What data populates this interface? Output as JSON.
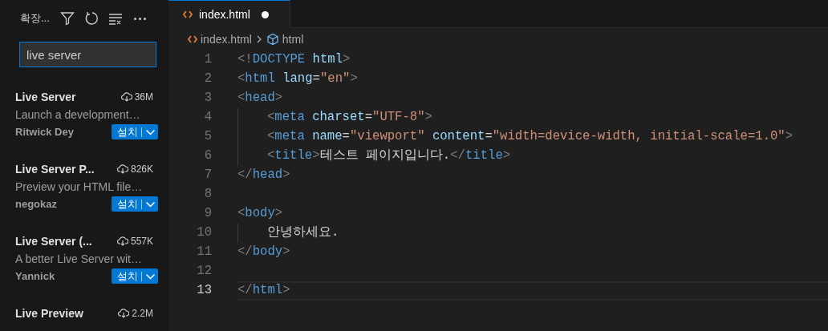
{
  "sidebar": {
    "title": "확장...",
    "search": {
      "value": "live server"
    },
    "extensions": [
      {
        "name": "Live Server",
        "downloads": "36M",
        "description": "Launch a development…",
        "author": "Ritwick Dey",
        "install": "설치"
      },
      {
        "name": "Live Server P...",
        "downloads": "826K",
        "description": "Preview your HTML file…",
        "author": "negokaz",
        "install": "설치"
      },
      {
        "name": "Live Server (...",
        "downloads": "557K",
        "description": "A better Live Server wit…",
        "author": "Yannick",
        "install": "설치"
      },
      {
        "name": "Live Preview",
        "downloads": "2.2M"
      }
    ]
  },
  "tabs": [
    {
      "label": "index.html",
      "selected": true,
      "modified": true
    }
  ],
  "breadcrumb": [
    "index.html",
    "html"
  ],
  "editor": {
    "lines": [
      {
        "number": "1",
        "indented": false,
        "current": false,
        "tokens": [
          {
            "kind": "punct",
            "text": "<!"
          },
          {
            "kind": "doctype",
            "text": "DOCTYPE"
          },
          {
            "kind": "attr",
            "text": " html"
          },
          {
            "kind": "punct",
            "text": ">"
          }
        ]
      },
      {
        "number": "2",
        "indented": false,
        "current": false,
        "tokens": [
          {
            "kind": "punct",
            "text": "<"
          },
          {
            "kind": "tag",
            "text": "html"
          },
          {
            "kind": "attr",
            "text": " lang"
          },
          {
            "kind": "text",
            "text": "="
          },
          {
            "kind": "string",
            "text": "\"en\""
          },
          {
            "kind": "punct",
            "text": ">"
          }
        ]
      },
      {
        "number": "3",
        "indented": false,
        "current": false,
        "tokens": [
          {
            "kind": "punct",
            "text": "<"
          },
          {
            "kind": "tag",
            "text": "head"
          },
          {
            "kind": "punct",
            "text": ">"
          }
        ]
      },
      {
        "number": "4",
        "indented": true,
        "current": false,
        "tokens": [
          {
            "kind": "punct",
            "text": "<"
          },
          {
            "kind": "tag",
            "text": "meta"
          },
          {
            "kind": "attr",
            "text": " charset"
          },
          {
            "kind": "text",
            "text": "="
          },
          {
            "kind": "string",
            "text": "\"UTF-8\""
          },
          {
            "kind": "punct",
            "text": ">"
          }
        ]
      },
      {
        "number": "5",
        "indented": true,
        "current": false,
        "tokens": [
          {
            "kind": "punct",
            "text": "<"
          },
          {
            "kind": "tag",
            "text": "meta"
          },
          {
            "kind": "attr",
            "text": " name"
          },
          {
            "kind": "text",
            "text": "="
          },
          {
            "kind": "string",
            "text": "\"viewport\""
          },
          {
            "kind": "attr",
            "text": " content"
          },
          {
            "kind": "text",
            "text": "="
          },
          {
            "kind": "string",
            "text": "\"width=device-width, initial-scale=1.0\""
          },
          {
            "kind": "punct",
            "text": ">"
          }
        ]
      },
      {
        "number": "6",
        "indented": true,
        "current": false,
        "tokens": [
          {
            "kind": "punct",
            "text": "<"
          },
          {
            "kind": "tag",
            "text": "title"
          },
          {
            "kind": "punct",
            "text": ">"
          },
          {
            "kind": "text",
            "text": "테스트 페이지입니다."
          },
          {
            "kind": "punct",
            "text": "</"
          },
          {
            "kind": "tag",
            "text": "title"
          },
          {
            "kind": "punct",
            "text": ">"
          }
        ]
      },
      {
        "number": "7",
        "indented": false,
        "current": false,
        "tokens": [
          {
            "kind": "punct",
            "text": "</"
          },
          {
            "kind": "tag",
            "text": "head"
          },
          {
            "kind": "punct",
            "text": ">"
          }
        ]
      },
      {
        "number": "8",
        "indented": false,
        "current": false
      },
      {
        "number": "9",
        "indented": false,
        "current": false,
        "tokens": [
          {
            "kind": "punct",
            "text": "<"
          },
          {
            "kind": "tag",
            "text": "body"
          },
          {
            "kind": "punct",
            "text": ">"
          }
        ]
      },
      {
        "number": "10",
        "indented": true,
        "current": false,
        "tokens": [
          {
            "kind": "text",
            "text": "안녕하세요."
          }
        ]
      },
      {
        "number": "11",
        "indented": false,
        "current": false,
        "tokens": [
          {
            "kind": "punct",
            "text": "</"
          },
          {
            "kind": "tag",
            "text": "body"
          },
          {
            "kind": "punct",
            "text": ">"
          }
        ]
      },
      {
        "number": "12",
        "indented": false,
        "current": false
      },
      {
        "number": "13",
        "indented": false,
        "current": true,
        "tokens": [
          {
            "kind": "punct",
            "text": "</"
          },
          {
            "kind": "tag",
            "text": "html"
          },
          {
            "kind": "punct",
            "text": ">"
          }
        ]
      }
    ]
  }
}
